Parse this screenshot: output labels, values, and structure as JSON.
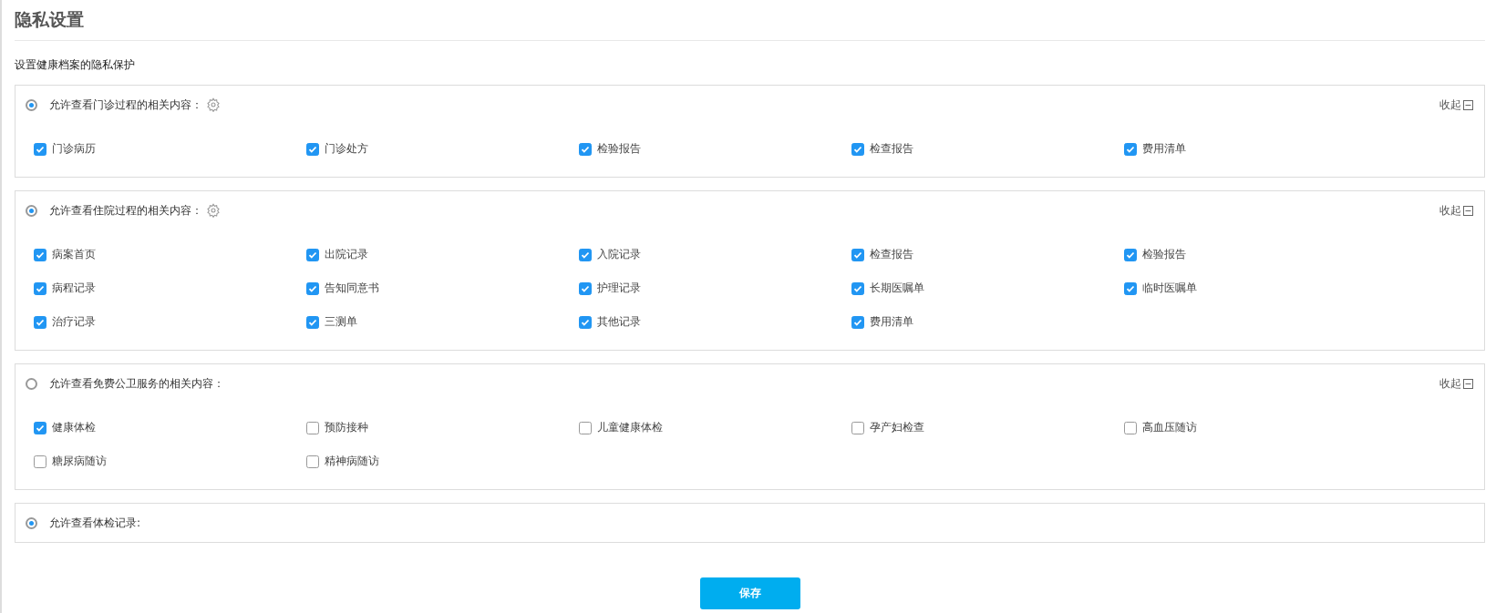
{
  "title": "隐私设置",
  "subtitle": "设置健康档案的隐私保护",
  "sections": [
    {
      "label": "允许查看门诊过程的相关内容：",
      "selected": true,
      "has_settings": true,
      "collapse_label": "收起",
      "items": [
        {
          "label": "门诊病历",
          "checked": true
        },
        {
          "label": "门诊处方",
          "checked": true
        },
        {
          "label": "检验报告",
          "checked": true
        },
        {
          "label": "检查报告",
          "checked": true
        },
        {
          "label": "费用清单",
          "checked": true
        }
      ]
    },
    {
      "label": "允许查看住院过程的相关内容：",
      "selected": true,
      "has_settings": true,
      "collapse_label": "收起",
      "items": [
        {
          "label": "病案首页",
          "checked": true
        },
        {
          "label": "出院记录",
          "checked": true
        },
        {
          "label": "入院记录",
          "checked": true
        },
        {
          "label": "检查报告",
          "checked": true
        },
        {
          "label": "检验报告",
          "checked": true
        },
        {
          "label": "病程记录",
          "checked": true
        },
        {
          "label": "告知同意书",
          "checked": true
        },
        {
          "label": "护理记录",
          "checked": true
        },
        {
          "label": "长期医嘱单",
          "checked": true
        },
        {
          "label": "临时医嘱单",
          "checked": true
        },
        {
          "label": "治疗记录",
          "checked": true
        },
        {
          "label": "三测单",
          "checked": true
        },
        {
          "label": "其他记录",
          "checked": true
        },
        {
          "label": "费用清单",
          "checked": true
        }
      ]
    },
    {
      "label": "允许查看免费公卫服务的相关内容：",
      "selected": false,
      "has_settings": false,
      "collapse_label": "收起",
      "items": [
        {
          "label": "健康体检",
          "checked": true
        },
        {
          "label": "预防接种",
          "checked": false
        },
        {
          "label": "儿童健康体检",
          "checked": false
        },
        {
          "label": "孕产妇检查",
          "checked": false
        },
        {
          "label": "高血压随访",
          "checked": false
        },
        {
          "label": "糖尿病随访",
          "checked": false
        },
        {
          "label": "精神病随访",
          "checked": false
        }
      ]
    },
    {
      "label": "允许查看体检记录:",
      "selected": true,
      "has_settings": false
    }
  ],
  "save_button": "保存"
}
